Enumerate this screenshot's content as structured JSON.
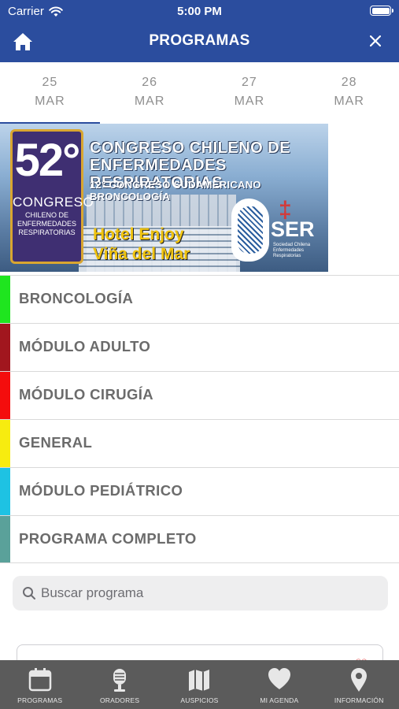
{
  "status_bar": {
    "carrier": "Carrier",
    "time": "5:00 PM"
  },
  "header": {
    "title": "PROGRAMAS",
    "home_icon": "home-icon",
    "close_icon": "close-icon"
  },
  "dates": [
    {
      "day": "25",
      "month": "MAR",
      "active": true
    },
    {
      "day": "26",
      "month": "MAR",
      "active": false
    },
    {
      "day": "27",
      "month": "MAR",
      "active": false
    },
    {
      "day": "28",
      "month": "MAR",
      "active": false
    }
  ],
  "banner": {
    "edition": "52°",
    "badge_word": "CONGRESO",
    "badge_sub": "CHILENO DE ENFERMEDADES RESPIRATORIAS",
    "title_line1": "CONGRESO  CHILENO DE",
    "title_line2": "ENFERMEDADES RESPIRATORIAS",
    "subtitle": "12°  CONGRESO SUDAMERICANO BRONCOLOGÍA",
    "venue_line1": "Hotel Enjoy",
    "venue_line2": "Viña del Mar",
    "org_abbr": "SER",
    "org_name": "Sociedad Chilena Enfermedades Respiratorias"
  },
  "categories": [
    {
      "label": "BRONCOLOGÍA",
      "color": "#1fe51f"
    },
    {
      "label": "MÓDULO ADULTO",
      "color": "#a1161e"
    },
    {
      "label": "MÓDULO CIRUGÍA",
      "color": "#f40d0d"
    },
    {
      "label": "GENERAL",
      "color": "#f7ec0f"
    },
    {
      "label": "MÓDULO PEDIÁTRICO",
      "color": "#1ec2e3"
    },
    {
      "label": "PROGRAMA COMPLETO",
      "color": "#5aa19a"
    }
  ],
  "search": {
    "placeholder": "Buscar programa"
  },
  "tabbar": [
    {
      "label": "PROGRAMAS",
      "icon": "calendar-icon"
    },
    {
      "label": "ORADORES",
      "icon": "microphone-icon"
    },
    {
      "label": "AUSPICIOS",
      "icon": "map-icon"
    },
    {
      "label": "MI AGENDA",
      "icon": "heart-icon"
    },
    {
      "label": "INFORMACIÓN",
      "icon": "location-pin-icon"
    }
  ]
}
